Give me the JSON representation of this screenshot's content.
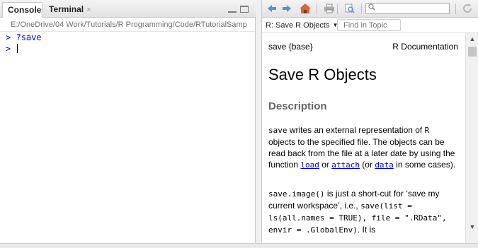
{
  "console_pane": {
    "tabs": [
      {
        "label": "Console",
        "active": true
      },
      {
        "label": "Terminal",
        "close_glyph": "×"
      }
    ],
    "working_dir": "E:/OneDrive/04 Work/Tutorials/R Programming/Code/RTutorialSamp",
    "lines": [
      {
        "prompt": ">",
        "text": "?save"
      },
      {
        "prompt": ">",
        "text": ""
      }
    ],
    "prompt_color": "#0000ee"
  },
  "help_pane": {
    "toolbar": {
      "icons": [
        "back-arrow-icon",
        "forward-arrow-icon",
        "home-icon",
        "print-icon",
        "find-page-icon",
        "search-icon",
        "refresh-icon"
      ],
      "search_placeholder": ""
    },
    "topic_dropdown": "R: Save R Objects",
    "find_in_topic_placeholder": "Find in Topic",
    "doc": {
      "header_left": "save {base}",
      "header_right": "R Documentation",
      "title": "Save R Objects",
      "section": "Description",
      "p1": {
        "code_save": "save",
        "t1": " writes an external representation of ",
        "code_r": "R",
        "t2": " objects to the specified file. The objects can be read back from the file at a later date by using the function ",
        "link_load": "load",
        "t3": " or ",
        "link_attach": "attach",
        "t4": " (or ",
        "link_data": "data",
        "t5": " in some cases)."
      },
      "p2": {
        "code_save_image": "save.image()",
        "t1": " is just a short-cut for ‘save my current workspace’, i.e., ",
        "code_expr": "save(list = ls(all.names = TRUE), file = \".RData\", envir = .GlobalEnv)",
        "t2": ". It is"
      }
    },
    "accent_link_color": "#0000cc"
  }
}
